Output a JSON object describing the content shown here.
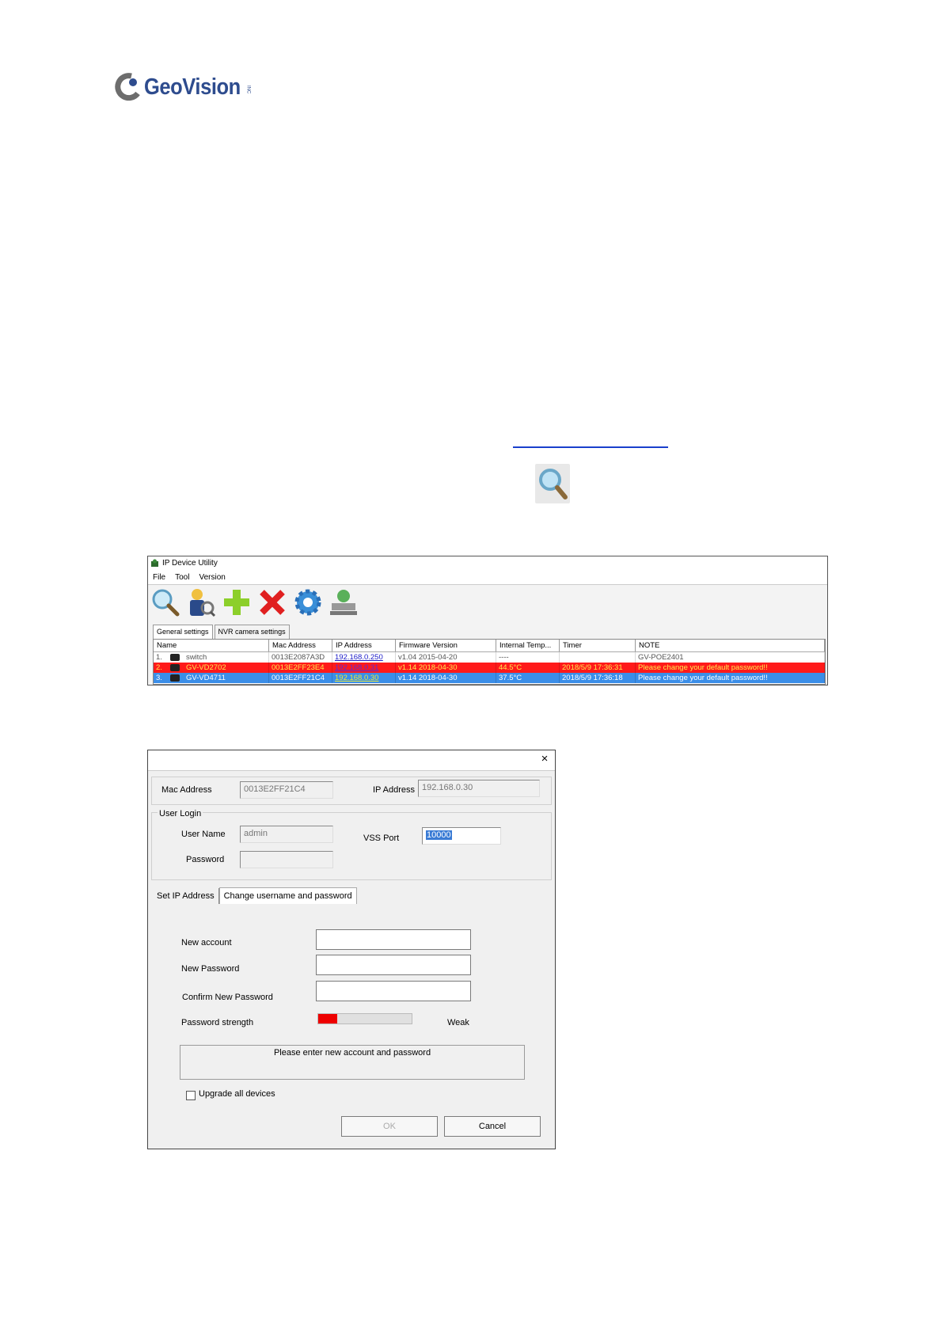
{
  "logo": {
    "brand": "GeoVision",
    "suffix": "INC"
  },
  "utility_window": {
    "title": "IP Device Utility",
    "menu": [
      "File",
      "Tool",
      "Version"
    ],
    "toolbar": [
      {
        "icon": "search-icon"
      },
      {
        "icon": "user-settings-icon"
      },
      {
        "icon": "add-icon"
      },
      {
        "icon": "delete-icon"
      },
      {
        "icon": "gear-icon"
      },
      {
        "icon": "network-icon"
      }
    ],
    "tabs": [
      "General settings",
      "NVR camera settings"
    ],
    "columns": [
      "Name",
      "Mac Address",
      "IP Address",
      "Firmware Version",
      "Internal Temp...",
      "Timer",
      "NOTE"
    ],
    "rows": [
      {
        "num": "1.",
        "name": "switch",
        "mac": "0013E2087A3D",
        "ip": "192.168.0.250",
        "fw": "v1.04  2015-04-20",
        "temp": "----",
        "timer": "",
        "note": "GV-POE2401"
      },
      {
        "num": "2.",
        "name": "GV-VD2702",
        "mac": "0013E2FF23E4",
        "ip": "192.168.0.31",
        "fw": "v1.14  2018-04-30",
        "temp": "44.5°C",
        "timer": "2018/5/9 17:36:31",
        "note": "Please change your default password!!"
      },
      {
        "num": "3.",
        "name": "GV-VD4711",
        "mac": "0013E2FF21C4",
        "ip": "192.168.0.30",
        "fw": "v1.14  2018-04-30",
        "temp": "37.5°C",
        "timer": "2018/5/9 17:36:18",
        "note": "Please change your default password!!"
      }
    ]
  },
  "dialog": {
    "close": "×",
    "mac_label": "Mac Address",
    "mac_value": "0013E2FF21C4",
    "ip_label": "IP Address",
    "ip_value": "192.168.0.30",
    "user_login_group": "User Login",
    "username_label": "User Name",
    "username_value": "admin",
    "password_label": "Password",
    "vss_label": "VSS Port",
    "vss_value": "10000",
    "tabs": [
      "Set IP Address",
      "Change username and password"
    ],
    "new_account_label": "New account",
    "new_password_label": "New Password",
    "confirm_label": "Confirm New Password",
    "strength_label": "Password strength",
    "strength_value": "Weak",
    "strength_fraction": 0.2,
    "message": "Please enter new account and password",
    "upgrade_label": "Upgrade all devices",
    "ok_label": "OK",
    "cancel_label": "Cancel"
  }
}
